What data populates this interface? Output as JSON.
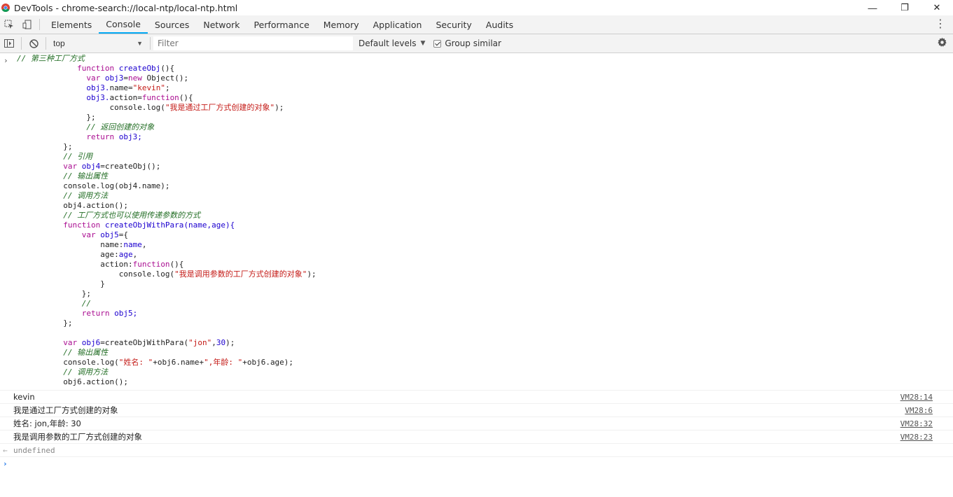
{
  "window": {
    "title": "DevTools - chrome-search://local-ntp/local-ntp.html",
    "controls": [
      "—",
      "❐",
      "✕"
    ]
  },
  "tabs": [
    {
      "label": "Elements",
      "active": false
    },
    {
      "label": "Console",
      "active": true
    },
    {
      "label": "Sources",
      "active": false
    },
    {
      "label": "Network",
      "active": false
    },
    {
      "label": "Performance",
      "active": false
    },
    {
      "label": "Memory",
      "active": false
    },
    {
      "label": "Application",
      "active": false
    },
    {
      "label": "Security",
      "active": false
    },
    {
      "label": "Audits",
      "active": false
    }
  ],
  "toolbar": {
    "context": "top",
    "filter_placeholder": "Filter",
    "levels": "Default levels",
    "group_similar": "Group similar",
    "group_similar_checked": true
  },
  "code_lines": [
    {
      "indent": 0,
      "parts": [
        {
          "t": "// 第三种工厂方式",
          "c": "comment"
        }
      ]
    },
    {
      "indent": 13,
      "parts": [
        {
          "t": "function ",
          "c": "kw"
        },
        {
          "t": "createObj",
          "c": "fn"
        },
        {
          "t": "(){",
          "c": ""
        }
      ]
    },
    {
      "indent": 15,
      "parts": [
        {
          "t": "var ",
          "c": "kw"
        },
        {
          "t": "obj3",
          "c": "fn"
        },
        {
          "t": "=",
          "c": ""
        },
        {
          "t": "new ",
          "c": "kw"
        },
        {
          "t": "Object();",
          "c": ""
        }
      ]
    },
    {
      "indent": 15,
      "parts": [
        {
          "t": "obj3.",
          "c": "fn"
        },
        {
          "t": "name=",
          "c": ""
        },
        {
          "t": "\"kevin\"",
          "c": "str"
        },
        {
          "t": ";",
          "c": ""
        }
      ]
    },
    {
      "indent": 15,
      "parts": [
        {
          "t": "obj3.",
          "c": "fn"
        },
        {
          "t": "action=",
          "c": ""
        },
        {
          "t": "function",
          "c": "kw"
        },
        {
          "t": "(){",
          "c": ""
        }
      ]
    },
    {
      "indent": 20,
      "parts": [
        {
          "t": "console.log(",
          "c": ""
        },
        {
          "t": "\"我是通过工厂方式创建的对象\"",
          "c": "str"
        },
        {
          "t": ");",
          "c": ""
        }
      ]
    },
    {
      "indent": 15,
      "parts": [
        {
          "t": "};",
          "c": ""
        }
      ]
    },
    {
      "indent": 15,
      "parts": [
        {
          "t": "// 返回创建的对象",
          "c": "comment"
        }
      ]
    },
    {
      "indent": 15,
      "parts": [
        {
          "t": "return ",
          "c": "kw"
        },
        {
          "t": "obj3;",
          "c": "fn"
        }
      ]
    },
    {
      "indent": 10,
      "parts": [
        {
          "t": "};",
          "c": ""
        }
      ]
    },
    {
      "indent": 10,
      "parts": [
        {
          "t": "// 引用",
          "c": "comment"
        }
      ]
    },
    {
      "indent": 10,
      "parts": [
        {
          "t": "var ",
          "c": "kw"
        },
        {
          "t": "obj4",
          "c": "fn"
        },
        {
          "t": "=createObj();",
          "c": ""
        }
      ]
    },
    {
      "indent": 10,
      "parts": [
        {
          "t": "// 输出属性",
          "c": "comment"
        }
      ]
    },
    {
      "indent": 10,
      "parts": [
        {
          "t": "console.log(obj4.name);",
          "c": ""
        }
      ]
    },
    {
      "indent": 10,
      "parts": [
        {
          "t": "// 调用方法",
          "c": "comment"
        }
      ]
    },
    {
      "indent": 10,
      "parts": [
        {
          "t": "obj4.action();",
          "c": ""
        }
      ]
    },
    {
      "indent": 10,
      "parts": [
        {
          "t": "// 工厂方式也可以使用传递参数的方式",
          "c": "comment"
        }
      ]
    },
    {
      "indent": 10,
      "parts": [
        {
          "t": "function ",
          "c": "kw"
        },
        {
          "t": "createObjWithPara",
          "c": "fn"
        },
        {
          "t": "(name,age){",
          "c": "fn"
        }
      ]
    },
    {
      "indent": 14,
      "parts": [
        {
          "t": "var ",
          "c": "kw"
        },
        {
          "t": "obj5",
          "c": "fn"
        },
        {
          "t": "={",
          "c": ""
        }
      ]
    },
    {
      "indent": 18,
      "parts": [
        {
          "t": "name:",
          "c": ""
        },
        {
          "t": "name",
          "c": "fn"
        },
        {
          "t": ",",
          "c": ""
        }
      ]
    },
    {
      "indent": 18,
      "parts": [
        {
          "t": "age:",
          "c": ""
        },
        {
          "t": "age",
          "c": "fn"
        },
        {
          "t": ",",
          "c": ""
        }
      ]
    },
    {
      "indent": 18,
      "parts": [
        {
          "t": "action:",
          "c": ""
        },
        {
          "t": "function",
          "c": "kw"
        },
        {
          "t": "(){",
          "c": ""
        }
      ]
    },
    {
      "indent": 22,
      "parts": [
        {
          "t": "console.log(",
          "c": ""
        },
        {
          "t": "\"我是调用参数的工厂方式创建的对象\"",
          "c": "str"
        },
        {
          "t": ");",
          "c": ""
        }
      ]
    },
    {
      "indent": 18,
      "parts": [
        {
          "t": "}",
          "c": ""
        }
      ]
    },
    {
      "indent": 14,
      "parts": [
        {
          "t": "};",
          "c": ""
        }
      ]
    },
    {
      "indent": 14,
      "parts": [
        {
          "t": "//",
          "c": "comment"
        }
      ]
    },
    {
      "indent": 14,
      "parts": [
        {
          "t": "return ",
          "c": "kw"
        },
        {
          "t": "obj5;",
          "c": "fn"
        }
      ]
    },
    {
      "indent": 10,
      "parts": [
        {
          "t": "};",
          "c": ""
        }
      ]
    },
    {
      "indent": 0,
      "parts": [
        {
          "t": "",
          "c": ""
        }
      ]
    },
    {
      "indent": 10,
      "parts": [
        {
          "t": "var ",
          "c": "kw"
        },
        {
          "t": "obj6",
          "c": "fn"
        },
        {
          "t": "=createObjWithPara(",
          "c": ""
        },
        {
          "t": "\"jon\"",
          "c": "str"
        },
        {
          "t": ",",
          "c": ""
        },
        {
          "t": "30",
          "c": "num"
        },
        {
          "t": ");",
          "c": ""
        }
      ]
    },
    {
      "indent": 10,
      "parts": [
        {
          "t": "// 输出属性",
          "c": "comment"
        }
      ]
    },
    {
      "indent": 10,
      "parts": [
        {
          "t": "console.log(",
          "c": ""
        },
        {
          "t": "\"姓名: \"",
          "c": "str"
        },
        {
          "t": "+obj6.name+",
          "c": ""
        },
        {
          "t": "\",年龄: \"",
          "c": "str"
        },
        {
          "t": "+obj6.age);",
          "c": ""
        }
      ]
    },
    {
      "indent": 10,
      "parts": [
        {
          "t": "// 调用方法",
          "c": "comment"
        }
      ]
    },
    {
      "indent": 10,
      "parts": [
        {
          "t": "obj6.action();",
          "c": ""
        }
      ]
    }
  ],
  "logs": [
    {
      "text": "kevin",
      "source": "VM28:14"
    },
    {
      "text": "我是通过工厂方式创建的对象",
      "source": "VM28:6"
    },
    {
      "text": "姓名: jon,年龄: 30",
      "source": "VM28:32"
    },
    {
      "text": "我是调用参数的工厂方式创建的对象",
      "source": "VM28:23"
    }
  ],
  "result": "undefined"
}
